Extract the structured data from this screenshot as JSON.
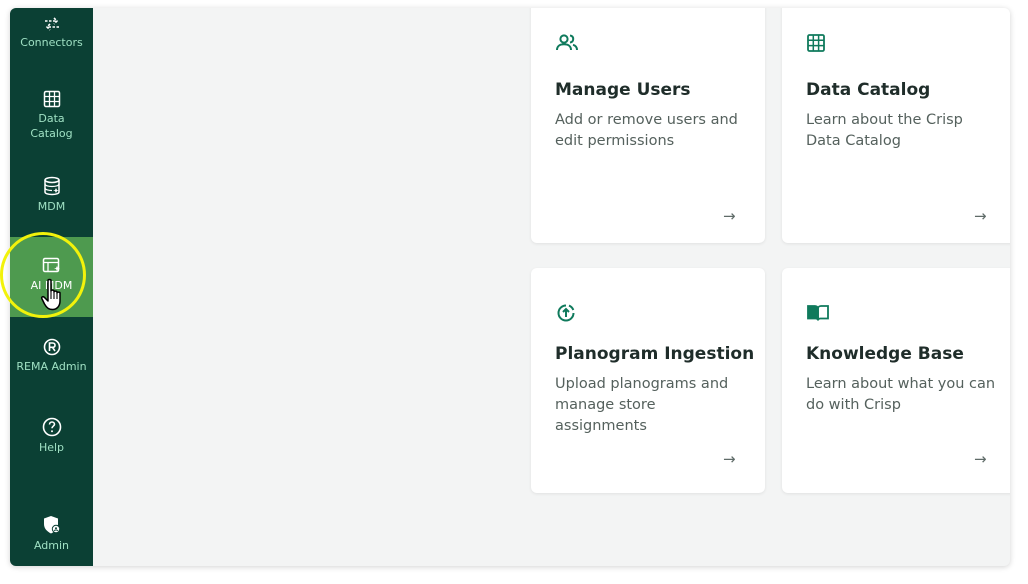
{
  "sidebar": {
    "items": [
      {
        "label": "Connectors",
        "icon": "connectors-icon"
      },
      {
        "label": "Data\nCatalog",
        "icon": "table-grid-icon"
      },
      {
        "label": "MDM",
        "icon": "database-icon"
      },
      {
        "label": "AI MDM",
        "icon": "ai-table-icon",
        "active": true
      },
      {
        "label": "REMA Admin",
        "icon": "rema-r-icon"
      },
      {
        "label": "Help",
        "icon": "help-circle-icon"
      },
      {
        "label": "Admin",
        "icon": "admin-shield-icon"
      }
    ]
  },
  "cards": [
    {
      "title": "Manage Users",
      "desc": "Add or remove users and edit permissions",
      "icon": "users-icon",
      "arrow": "→"
    },
    {
      "title": "Data Catalog",
      "desc": "Learn about the Crisp Data Catalog",
      "icon": "table-grid-icon",
      "arrow": "→"
    },
    {
      "title": "Planogram Ingestion",
      "desc": "Upload planograms and manage store assignments",
      "icon": "upload-circle-icon",
      "arrow": "→"
    },
    {
      "title": "Knowledge Base",
      "desc": "Learn about what you can do with Crisp",
      "icon": "book-icon",
      "arrow": "→"
    }
  ],
  "colors": {
    "sidebar_bg": "#0b4034",
    "sidebar_text": "#9fe0c3",
    "active_bg": "#4e9a4f",
    "accent": "#0f7a5c",
    "highlight": "#f2f20b"
  }
}
